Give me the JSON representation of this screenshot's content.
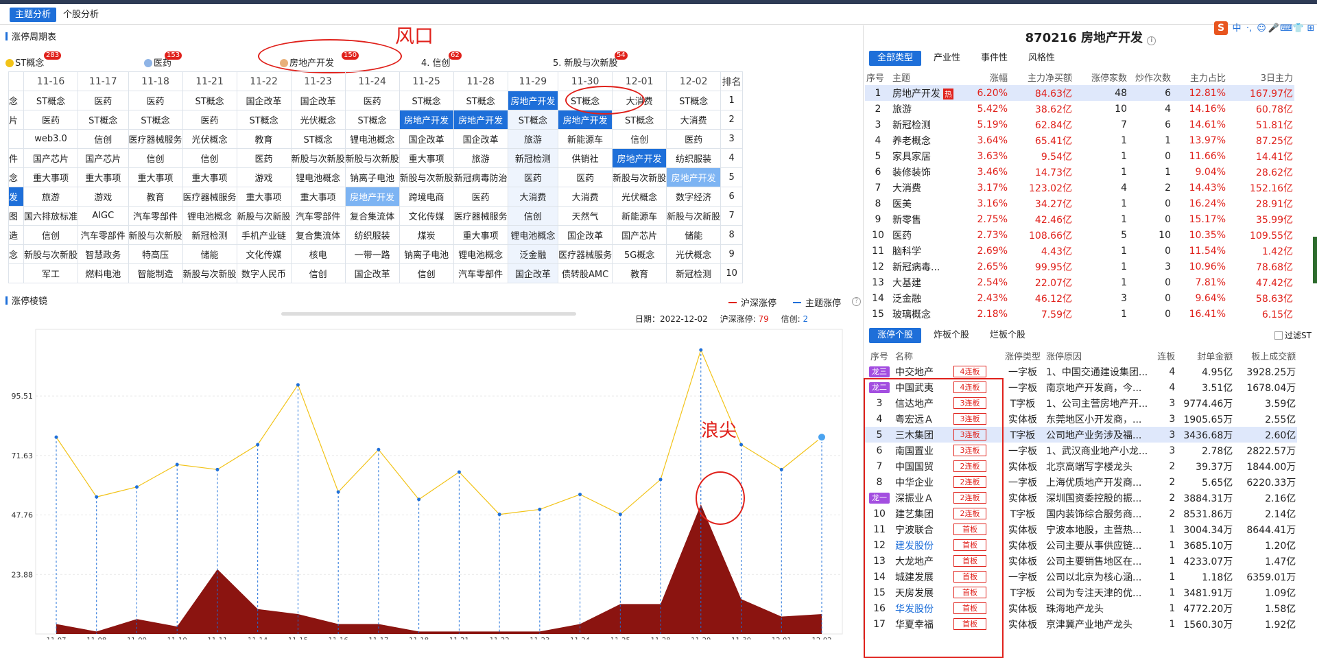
{
  "tabs": {
    "t1": "主题分析",
    "t2": "个股分析"
  },
  "cycle": {
    "title": "涨停周期表",
    "themes": [
      {
        "label": "ST概念",
        "count": "283"
      },
      {
        "label": "医药",
        "count": "153"
      },
      {
        "label": "房地产开发",
        "count": "150"
      },
      {
        "label": "4. 信创",
        "count": "62"
      },
      {
        "label": "5. 新股与次新股",
        "count": "54"
      }
    ],
    "annot_wind": "风口",
    "dates": [
      "11-16",
      "11-17",
      "11-18",
      "11-21",
      "11-22",
      "11-23",
      "11-24",
      "11-25",
      "11-28",
      "11-29",
      "11-30",
      "12-01",
      "12-02"
    ],
    "rank_header": "排名",
    "leftcol": [
      "念",
      "片",
      "",
      "件",
      "念",
      "发",
      "图",
      "造",
      "念",
      ""
    ],
    "rows": [
      [
        "ST概念",
        "医药",
        "医药",
        "ST概念",
        "国企改革",
        "国企改革",
        "医药",
        "ST概念",
        "ST概念",
        "房地产开发",
        "ST概念",
        "大消费",
        "ST概念",
        "1"
      ],
      [
        "医药",
        "ST概念",
        "ST概念",
        "医药",
        "ST概念",
        "光伏概念",
        "ST概念",
        "房地产开发",
        "房地产开发",
        "ST概念",
        "房地产开发",
        "ST概念",
        "大消费",
        "2"
      ],
      [
        "web3.0",
        "信创",
        "医疗器械服务",
        "光伏概念",
        "教育",
        "ST概念",
        "锂电池概念",
        "国企改革",
        "国企改革",
        "旅游",
        "新能源车",
        "信创",
        "医药",
        "3"
      ],
      [
        "国产芯片",
        "国产芯片",
        "信创",
        "信创",
        "医药",
        "新股与次新股",
        "新股与次新股",
        "重大事项",
        "旅游",
        "新冠检测",
        "供销社",
        "房地产开发",
        "纺织服装",
        "4"
      ],
      [
        "重大事项",
        "重大事项",
        "重大事项",
        "重大事项",
        "游戏",
        "锂电池概念",
        "钠离子电池",
        "新股与次新股",
        "新冠病毒防治",
        "医药",
        "医药",
        "新股与次新股",
        "房地产开发",
        "5"
      ],
      [
        "旅游",
        "游戏",
        "教育",
        "医疗器械服务",
        "重大事项",
        "重大事项",
        "房地产开发",
        "跨境电商",
        "医药",
        "大消费",
        "大消费",
        "光伏概念",
        "数字经济",
        "6"
      ],
      [
        "国六排放标准",
        "AIGC",
        "汽车零部件",
        "锂电池概念",
        "新股与次新股",
        "汽车零部件",
        "复合集流体",
        "文化传媒",
        "医疗器械服务",
        "信创",
        "天然气",
        "新能源车",
        "新股与次新股",
        "7"
      ],
      [
        "信创",
        "汽车零部件",
        "新股与次新股",
        "新冠检测",
        "手机产业链",
        "复合集流体",
        "纺织服装",
        "煤炭",
        "重大事项",
        "锂电池概念",
        "国企改革",
        "国产芯片",
        "储能",
        "8"
      ],
      [
        "新股与次新股",
        "智慧政务",
        "特高压",
        "储能",
        "文化传媒",
        "核电",
        "一带一路",
        "钠离子电池",
        "锂电池概念",
        "泛金融",
        "医疗器械服务",
        "5G概念",
        "光伏概念",
        "9"
      ],
      [
        "军工",
        "燃料电池",
        "智能制造",
        "新股与次新股",
        "数字人民币",
        "信创",
        "国企改革",
        "信创",
        "汽车零部件",
        "国企改革",
        "债转股AMC",
        "教育",
        "新冠检测",
        "10"
      ]
    ]
  },
  "mirror": {
    "title": "涨停棱镜",
    "legend1": "沪深涨停",
    "legend2": "主题涨停",
    "date_label": "日期：",
    "date": "2022-12-02",
    "hs_label": "沪深涨停:",
    "hs": "79",
    "xc_label": "信创:",
    "xc": "2",
    "annot_peak": "浪尖"
  },
  "chart_data": {
    "type": "line",
    "x": [
      "11-07",
      "11-08",
      "11-09",
      "11-10",
      "11-11",
      "11-14",
      "11-15",
      "11-16",
      "11-17",
      "11-18",
      "11-21",
      "11-22",
      "11-23",
      "11-24",
      "11-25",
      "11-28",
      "11-29",
      "11-30",
      "12-01",
      "12-02"
    ],
    "yticks": [
      23.88,
      47.76,
      71.63,
      95.51
    ],
    "ylim": [
      0,
      114
    ],
    "series": [
      {
        "name": "沪深涨停",
        "type": "line",
        "color": "#f2c318",
        "values": [
          79,
          55,
          59,
          68,
          66,
          76,
          100,
          57,
          74,
          54,
          65,
          48,
          50,
          56,
          48,
          62,
          114,
          76,
          66,
          79
        ]
      },
      {
        "name": "主题涨停",
        "type": "area",
        "color": "#8b1410",
        "values": [
          4,
          1,
          6,
          3,
          26,
          10,
          8,
          4,
          4,
          1,
          1,
          1,
          1,
          4,
          12,
          12,
          52,
          14,
          7,
          8
        ]
      }
    ]
  },
  "detail": {
    "title": "870216 房地产开发",
    "tabs": [
      "全部类型",
      "产业性",
      "事件性",
      "风格性"
    ],
    "headers": [
      "序号",
      "主题",
      "涨幅",
      "主力净买额",
      "涨停家数",
      "炒作次数",
      "主力占比",
      "3日主力"
    ],
    "hot": "热",
    "rows": [
      [
        "1",
        "房地产开发",
        "6.20%",
        "84.63亿",
        "48",
        "6",
        "12.81%",
        "167.97亿"
      ],
      [
        "2",
        "旅游",
        "5.42%",
        "38.62亿",
        "10",
        "4",
        "14.16%",
        "60.78亿"
      ],
      [
        "3",
        "新冠检测",
        "5.19%",
        "62.84亿",
        "7",
        "6",
        "14.61%",
        "51.81亿"
      ],
      [
        "4",
        "养老概念",
        "3.64%",
        "65.41亿",
        "1",
        "1",
        "13.97%",
        "87.25亿"
      ],
      [
        "5",
        "家具家居",
        "3.63%",
        "9.54亿",
        "1",
        "0",
        "11.66%",
        "14.41亿"
      ],
      [
        "6",
        "装修装饰",
        "3.46%",
        "14.73亿",
        "1",
        "1",
        "9.04%",
        "28.62亿"
      ],
      [
        "7",
        "大消费",
        "3.17%",
        "123.02亿",
        "4",
        "2",
        "14.43%",
        "152.16亿"
      ],
      [
        "8",
        "医美",
        "3.16%",
        "34.27亿",
        "1",
        "0",
        "16.24%",
        "28.91亿"
      ],
      [
        "9",
        "新零售",
        "2.75%",
        "42.46亿",
        "1",
        "0",
        "15.17%",
        "35.99亿"
      ],
      [
        "10",
        "医药",
        "2.73%",
        "108.66亿",
        "5",
        "10",
        "10.35%",
        "109.55亿"
      ],
      [
        "11",
        "脑科学",
        "2.69%",
        "4.43亿",
        "1",
        "0",
        "11.54%",
        "1.42亿"
      ],
      [
        "12",
        "新冠病毒...",
        "2.65%",
        "99.95亿",
        "1",
        "3",
        "10.96%",
        "78.68亿"
      ],
      [
        "13",
        "大基建",
        "2.54%",
        "22.07亿",
        "1",
        "0",
        "7.81%",
        "47.42亿"
      ],
      [
        "14",
        "泛金融",
        "2.43%",
        "46.12亿",
        "3",
        "0",
        "9.64%",
        "58.63亿"
      ],
      [
        "15",
        "玻璃概念",
        "2.18%",
        "7.59亿",
        "1",
        "0",
        "16.41%",
        "6.15亿"
      ]
    ]
  },
  "stocks": {
    "tabs": [
      "涨停个股",
      "炸板个股",
      "烂板个股"
    ],
    "filter": "过滤ST",
    "headers": [
      "序号",
      "名称",
      "",
      "涨停类型",
      "涨停原因",
      "连板",
      "封单金额",
      "板上成交额"
    ],
    "rows": [
      [
        "龙三",
        "中交地产",
        "4连板",
        "一字板",
        "1、中国交通建设集团...",
        "4",
        "4.95亿",
        "3928.25万"
      ],
      [
        "龙二",
        "中国武夷",
        "4连板",
        "一字板",
        "南京地产开发商，今...",
        "4",
        "3.51亿",
        "1678.04万"
      ],
      [
        "3",
        "信达地产",
        "3连板",
        "T字板",
        "1、公司主营房地产开...",
        "3",
        "9774.46万",
        "3.59亿"
      ],
      [
        "4",
        "粤宏远Ａ",
        "3连板",
        "实体板",
        "东莞地区小开发商，...",
        "3",
        "1905.65万",
        "2.55亿"
      ],
      [
        "5",
        "三木集团",
        "3连板",
        "T字板",
        "公司地产业务涉及福...",
        "3",
        "3436.68万",
        "2.60亿"
      ],
      [
        "6",
        "南国置业",
        "3连板",
        "一字板",
        "1、武汉商业地产小龙...",
        "3",
        "2.78亿",
        "2822.57万"
      ],
      [
        "7",
        "中国国贸",
        "2连板",
        "实体板",
        "北京高端写字楼龙头",
        "2",
        "39.37万",
        "1844.00万"
      ],
      [
        "8",
        "中华企业",
        "2连板",
        "一字板",
        "上海优质地产开发商...",
        "2",
        "5.65亿",
        "6220.33万"
      ],
      [
        "龙一",
        "深振业Ａ",
        "2连板",
        "实体板",
        "深圳国资委控股的振...",
        "2",
        "3884.31万",
        "2.16亿"
      ],
      [
        "10",
        "建艺集团",
        "2连板",
        "T字板",
        "国内装饰综合服务商...",
        "2",
        "8531.86万",
        "2.14亿"
      ],
      [
        "11",
        "宁波联合",
        "首板",
        "实体板",
        "宁波本地股，主营热...",
        "1",
        "3004.34万",
        "8644.41万"
      ],
      [
        "12",
        "建发股份",
        "首板",
        "实体板",
        "公司主要从事供应链...",
        "1",
        "3685.10万",
        "1.20亿"
      ],
      [
        "13",
        "大龙地产",
        "首板",
        "实体板",
        "公司主要销售地区在...",
        "1",
        "4233.07万",
        "1.47亿"
      ],
      [
        "14",
        "城建发展",
        "首板",
        "一字板",
        "公司以北京为核心涵...",
        "1",
        "1.18亿",
        "6359.01万"
      ],
      [
        "15",
        "天房发展",
        "首板",
        "T字板",
        "公司为专注天津的优...",
        "1",
        "3481.91万",
        "1.09亿"
      ],
      [
        "16",
        "华发股份",
        "首板",
        "实体板",
        "珠海地产龙头",
        "1",
        "4772.20万",
        "1.58亿"
      ],
      [
        "17",
        "华夏幸福",
        "首板",
        "实体板",
        "京津冀产业地产龙头",
        "1",
        "1560.30万",
        "1.92亿"
      ]
    ]
  },
  "ime": {
    "logo": "S",
    "items": [
      "中",
      "·,",
      "☺",
      "🎤",
      "⌨",
      "👕",
      "⊞"
    ]
  }
}
